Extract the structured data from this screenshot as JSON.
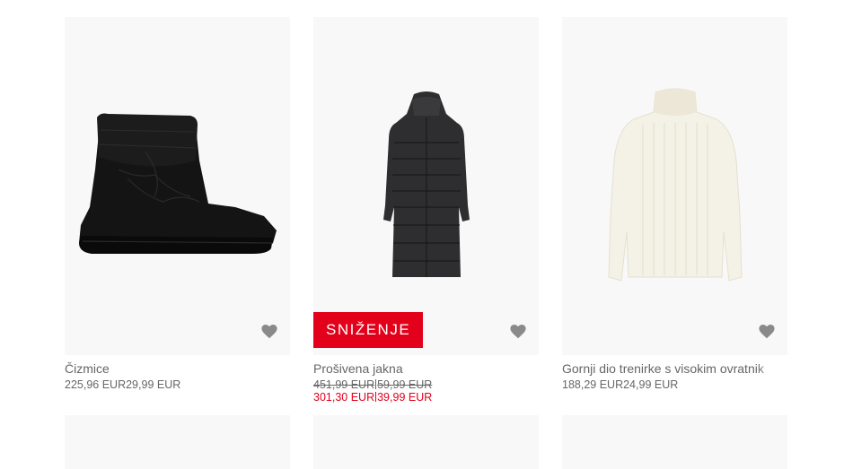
{
  "products": [
    {
      "name": "Čizmice",
      "image_icon": "snow-boot-image",
      "price_a": "225,96 EUR",
      "price_b": "29,99 EUR"
    },
    {
      "name": "Prošivena jakna",
      "image_icon": "puffer-coat-image",
      "badge": "SNIŽENJE",
      "old_price_a": "451,99 EUR",
      "old_price_b": "59,99 EUR",
      "sale_price_a": "301,30 EUR",
      "sale_price_b": "39,99 EUR"
    },
    {
      "name": "Gornji dio trenirke s visokim ovratnik",
      "image_icon": "turtleneck-sweater-image",
      "price_a": "188,29 EUR",
      "price_b": "24,99 EUR"
    }
  ],
  "colors": {
    "sale_red": "#e2001a",
    "card_bg": "#f8f8f8",
    "text": "#666666",
    "heart": "#8a8a8a"
  }
}
